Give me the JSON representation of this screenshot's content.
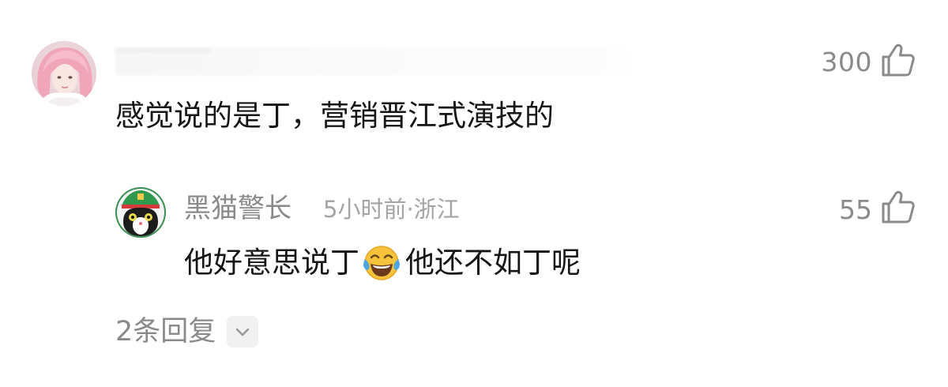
{
  "main_comment": {
    "username": "",
    "like_count": "300",
    "text": "感觉说的是丁，营销晋江式演技的"
  },
  "reply": {
    "author": "黑猫警长",
    "meta": "5小时前·浙江",
    "like_count": "55",
    "text_before_emoji": "他好意思说丁",
    "text_after_emoji": "他还不如丁呢"
  },
  "replies_toggle": {
    "label": "2条回复"
  },
  "icons": {
    "like": "thumbs-up-icon",
    "expand": "chevron-down-icon",
    "emoji": "laughing-tears-emoji"
  },
  "colors": {
    "secondary_text": "#8a8a8a",
    "primary_text": "#161616",
    "chevron_bg": "#f1f1f1"
  }
}
